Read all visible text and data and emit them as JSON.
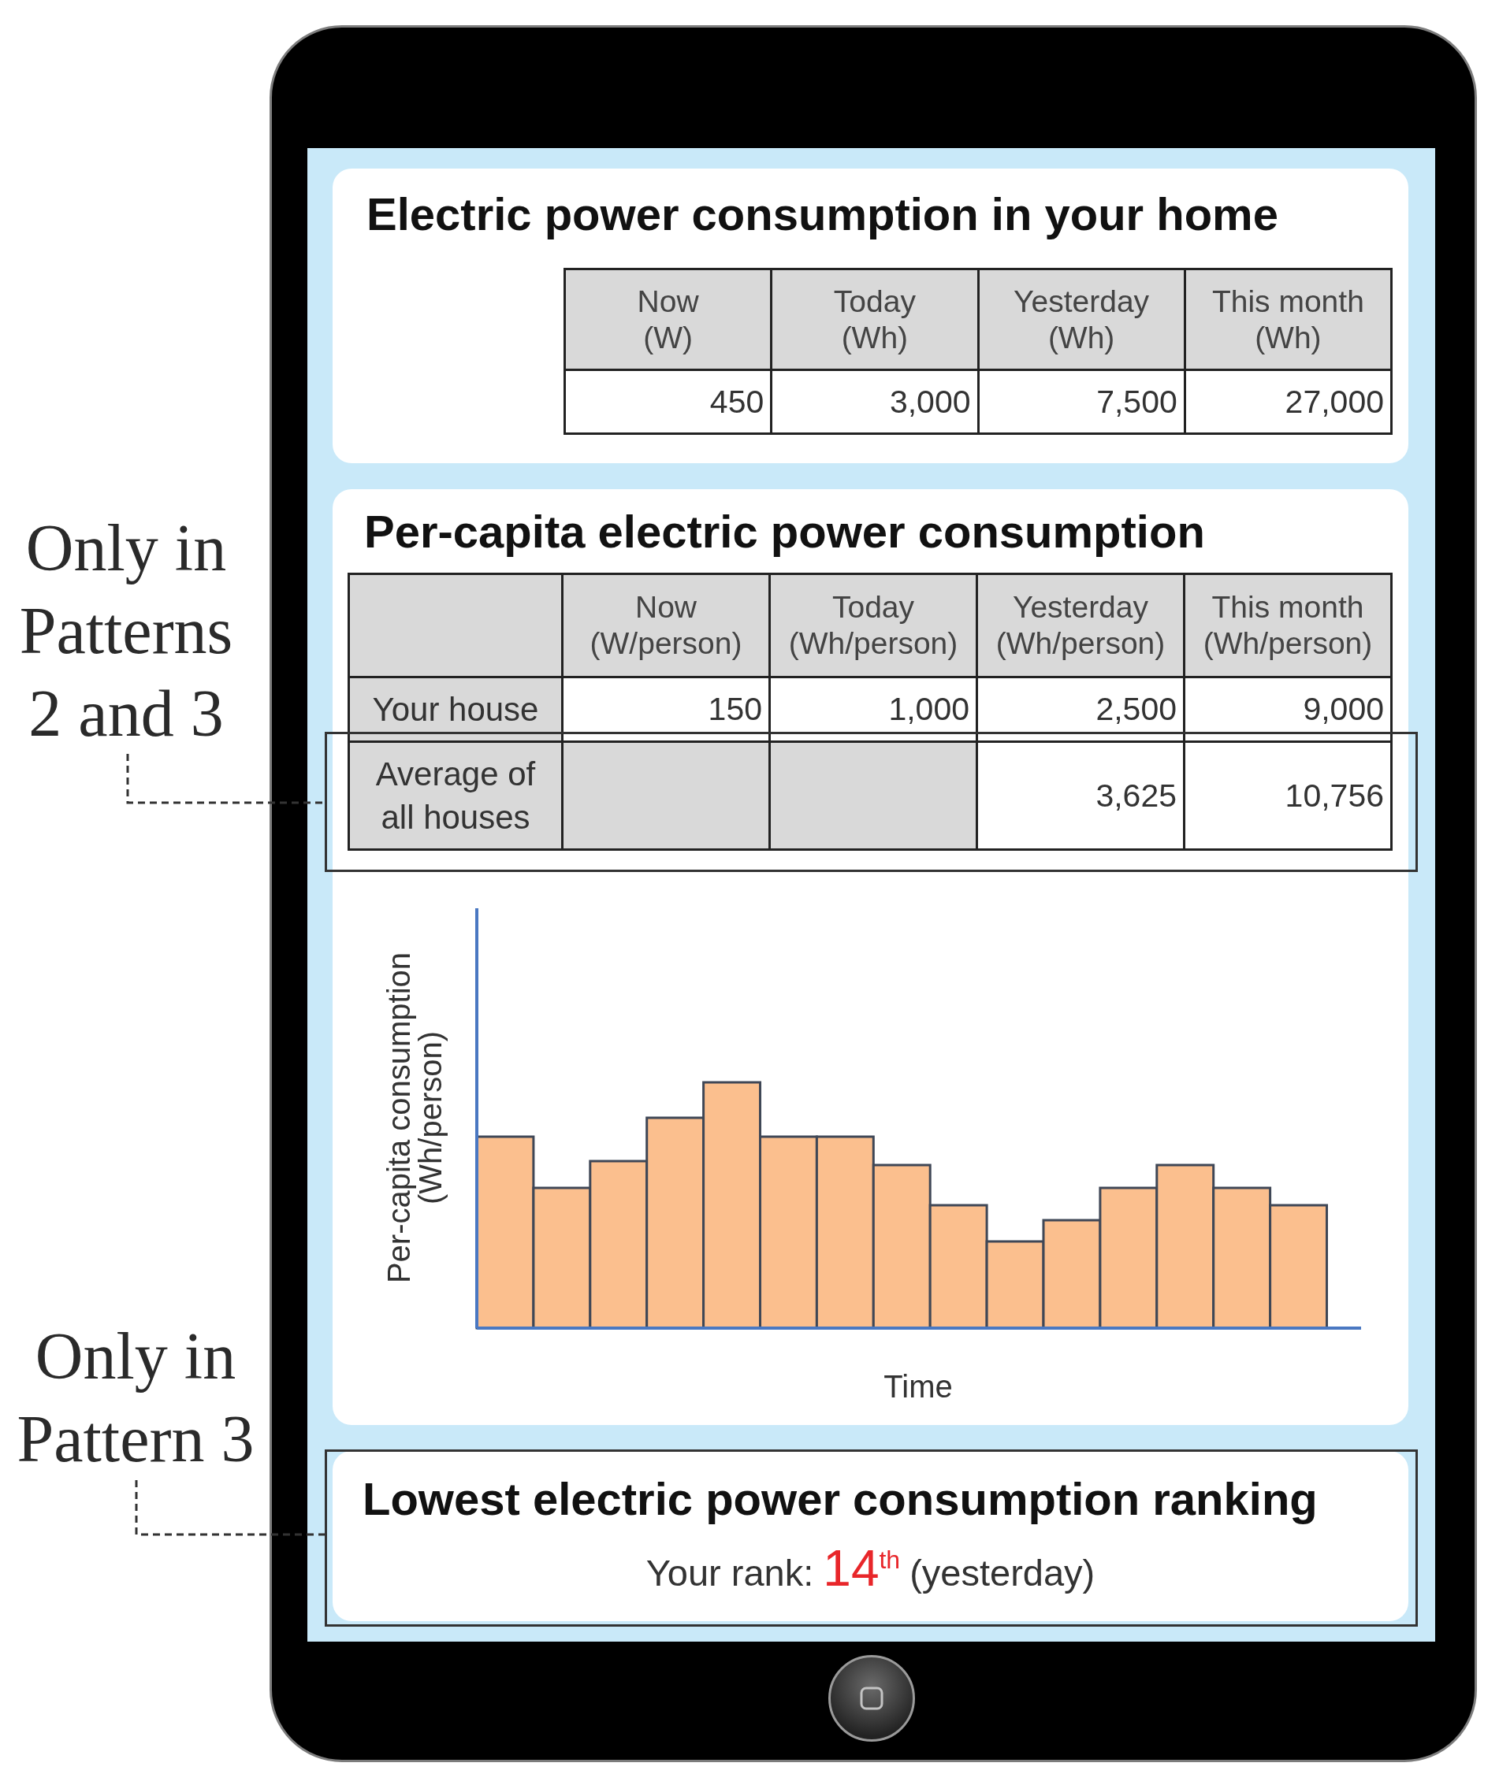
{
  "home_usage": {
    "title": "Electric power consumption in your home",
    "columns": [
      {
        "name": "Now",
        "unit": "(W)"
      },
      {
        "name": "Today",
        "unit": "(Wh)"
      },
      {
        "name": "Yesterday",
        "unit": "(Wh)"
      },
      {
        "name": "This month",
        "unit": "(Wh)"
      }
    ],
    "values": [
      "450",
      "3,000",
      "7,500",
      "27,000"
    ]
  },
  "per_capita": {
    "title": "Per-capita electric power consumption",
    "columns": [
      {
        "name": "Now",
        "unit": "(W/person)"
      },
      {
        "name": "Today",
        "unit": "(Wh/person)"
      },
      {
        "name": "Yesterday",
        "unit": "(Wh/person)"
      },
      {
        "name": "This month",
        "unit": "(Wh/person)"
      }
    ],
    "rows": [
      {
        "label": "Your house",
        "framed": false,
        "cells": [
          {
            "kind": "value",
            "text": "150"
          },
          {
            "kind": "value",
            "text": "1,000"
          },
          {
            "kind": "value",
            "text": "2,500"
          },
          {
            "kind": "value",
            "text": "9,000"
          }
        ]
      },
      {
        "label": "Average of all houses",
        "framed": true,
        "cells": [
          {
            "kind": "empty"
          },
          {
            "kind": "empty"
          },
          {
            "kind": "value",
            "text": "3,625"
          },
          {
            "kind": "value",
            "text": "10,756"
          }
        ]
      }
    ],
    "chart": {
      "y_label": [
        "Per-capita consumption",
        "(Wh/person)"
      ],
      "x_label": "Time"
    }
  },
  "ranking": {
    "title": "Lowest electric power consumption ranking",
    "framed": true,
    "label": "Your rank:",
    "rank": "14$^{th}$",
    "period": "(yesterday)"
  },
  "annotations": [
    {
      "kind": "row",
      "text": "Only in Patterns 2 and 3"
    },
    {
      "kind": "panel",
      "text": "Only in Pattern 3"
    }
  ]
}
